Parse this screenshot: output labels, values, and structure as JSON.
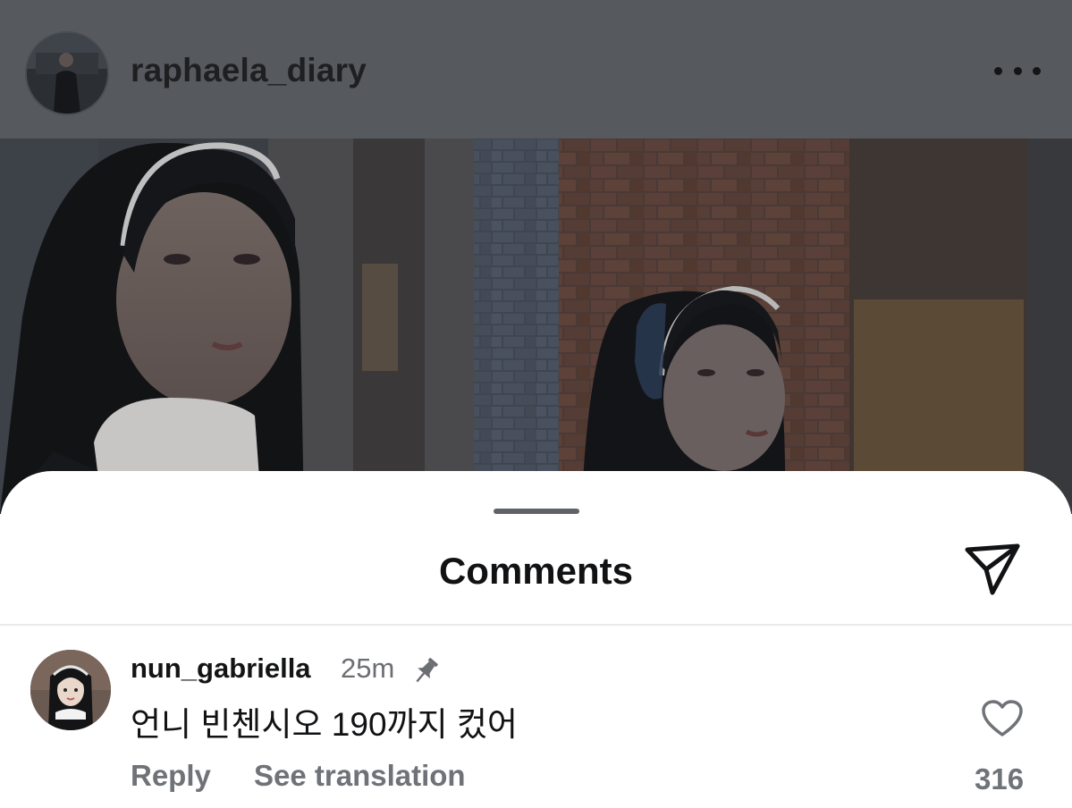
{
  "post": {
    "username": "raphaela_diary"
  },
  "sheet": {
    "title": "Comments"
  },
  "comment": {
    "username": "nun_gabriella",
    "time": "25m",
    "text": "언니 빈첸시오 190까지 컸어",
    "reply_label": "Reply",
    "translate_label": "See translation",
    "like_count": "316"
  },
  "colors": {
    "header_overlay": "#56595d",
    "sheet_bg": "#ffffff",
    "secondary_text": "#6f7277",
    "primary_text": "#111214"
  },
  "icons": {
    "more": "more-options-icon",
    "share": "paper-plane-icon",
    "pin": "pin-icon",
    "like": "heart-icon"
  }
}
